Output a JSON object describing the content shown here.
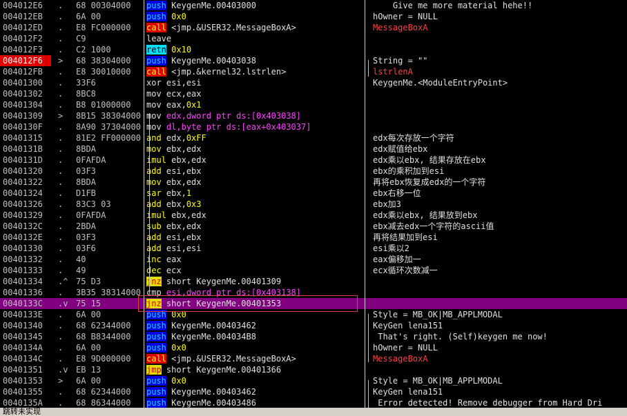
{
  "rows": [
    {
      "addr": "004012E6",
      "mark": ".",
      "hex": "68 00304000",
      "mn": "push",
      "op": "KeygenMe.00403000",
      "cmt": "    Give me more material hehe!!",
      "mnc": "push",
      "opc": "plain",
      "cmtc": "white"
    },
    {
      "addr": "004012EB",
      "mark": ".",
      "hex": "6A 00",
      "mn": "push",
      "op": "0x0",
      "cmt": "hOwner = NULL",
      "mnc": "push",
      "opc": "hex",
      "cmtc": "white"
    },
    {
      "addr": "004012ED",
      "mark": ".",
      "hex": "E8 FC000000",
      "mn": "call",
      "op": "<jmp.&USER32.MessageBoxA>",
      "cmt": "MessageBoxA",
      "mnc": "call",
      "opc": "plain",
      "cmtc": "red"
    },
    {
      "addr": "004012F2",
      "mark": ".",
      "hex": "C9",
      "mn": "leave",
      "op": "",
      "cmt": "",
      "mnc": "plainmn",
      "opc": "plain",
      "cmtc": "white"
    },
    {
      "addr": "004012F3",
      "mark": ".",
      "hex": "C2 1000",
      "mn": "retn",
      "op": "0x10",
      "cmt": "",
      "mnc": "retn",
      "opc": "hex",
      "cmtc": "white"
    },
    {
      "addr": "004012F6",
      "mark": ">",
      "hex": "68 38304000",
      "mn": "push",
      "op": "KeygenMe.00403038",
      "cmt": "String = \"\"",
      "mnc": "push",
      "opc": "plain",
      "cmtc": "white",
      "eip": true
    },
    {
      "addr": "004012FB",
      "mark": ".",
      "hex": "E8 30010000",
      "mn": "call",
      "op": "<jmp.&kernel32.lstrlen>",
      "cmt": "lstrlenA",
      "mnc": "call",
      "opc": "plain",
      "cmtc": "red"
    },
    {
      "addr": "00401300",
      "mark": ".",
      "hex": "33F6",
      "mn": "xor",
      "op": "esi,esi",
      "cmt": "KeygenMe.<ModuleEntryPoint>",
      "mnc": "plainmn",
      "opc": "plain",
      "cmtc": "white"
    },
    {
      "addr": "00401302",
      "mark": ".",
      "hex": "8BC8",
      "mn": "mov",
      "op": "ecx,eax",
      "cmt": "",
      "mnc": "plainmn",
      "opc": "plain",
      "cmtc": "white"
    },
    {
      "addr": "00401304",
      "mark": ".",
      "hex": "B8 01000000",
      "mn": "mov",
      "op": "eax,0x1",
      "cmt": "",
      "mnc": "plainmn",
      "opc": "mixhex",
      "cmtc": "white"
    },
    {
      "addr": "00401309",
      "mark": ">",
      "hex": "8B15 38304000",
      "mn": "mov",
      "op": "edx,dword ptr ds:[0x403038]",
      "cmt": "",
      "mnc": "plainmn",
      "opc": "mem",
      "cmtc": "white"
    },
    {
      "addr": "0040130F",
      "mark": ".",
      "hex": "8A90 37304000",
      "mn": "mov",
      "op": "dl,byte ptr ds:[eax+0x403037]",
      "cmt": "",
      "mnc": "plainmn",
      "opc": "mem",
      "cmtc": "white"
    },
    {
      "addr": "00401315",
      "mark": ".",
      "hex": "81E2 FF000000",
      "mn": "and",
      "op": "edx,0xFF",
      "cmt": "edx每次存放一个字符",
      "mnc": "arith",
      "opc": "mixhex",
      "cmtc": "white"
    },
    {
      "addr": "0040131B",
      "mark": ".",
      "hex": "8BDA",
      "mn": "mov",
      "op": "ebx,edx",
      "cmt": "edx赋值给ebx",
      "mnc": "arith",
      "opc": "plain",
      "cmtc": "white"
    },
    {
      "addr": "0040131D",
      "mark": ".",
      "hex": "0FAFDA",
      "mn": "imul",
      "op": "ebx,edx",
      "cmt": "edx乘以ebx, 结果存放在ebx",
      "mnc": "arith",
      "opc": "plain",
      "cmtc": "white"
    },
    {
      "addr": "00401320",
      "mark": ".",
      "hex": "03F3",
      "mn": "add",
      "op": "esi,ebx",
      "cmt": "ebx的乘积加到esi",
      "mnc": "arith",
      "opc": "plain",
      "cmtc": "white"
    },
    {
      "addr": "00401322",
      "mark": ".",
      "hex": "8BDA",
      "mn": "mov",
      "op": "ebx,edx",
      "cmt": "再将ebx恢复成edx的一个字符",
      "mnc": "arith",
      "opc": "plain",
      "cmtc": "white"
    },
    {
      "addr": "00401324",
      "mark": ".",
      "hex": "D1FB",
      "mn": "sar",
      "op": "ebx,1",
      "cmt": "ebx右移一位",
      "mnc": "arith",
      "opc": "mixhex",
      "cmtc": "white"
    },
    {
      "addr": "00401326",
      "mark": ".",
      "hex": "83C3 03",
      "mn": "add",
      "op": "ebx,0x3",
      "cmt": "ebx加3",
      "mnc": "arith",
      "opc": "mixhex",
      "cmtc": "white"
    },
    {
      "addr": "00401329",
      "mark": ".",
      "hex": "0FAFDA",
      "mn": "imul",
      "op": "ebx,edx",
      "cmt": "edx乘以ebx, 结果放到ebx",
      "mnc": "arith",
      "opc": "plain",
      "cmtc": "white"
    },
    {
      "addr": "0040132C",
      "mark": ".",
      "hex": "2BDA",
      "mn": "sub",
      "op": "ebx,edx",
      "cmt": "ebx减去edx一个字符的ascii值",
      "mnc": "arith",
      "opc": "plain",
      "cmtc": "white"
    },
    {
      "addr": "0040132E",
      "mark": ".",
      "hex": "03F3",
      "mn": "add",
      "op": "esi,ebx",
      "cmt": "再将结果加到esi",
      "mnc": "arith",
      "opc": "plain",
      "cmtc": "white"
    },
    {
      "addr": "00401330",
      "mark": ".",
      "hex": "03F6",
      "mn": "add",
      "op": "esi,esi",
      "cmt": "esi乘以2",
      "mnc": "arith",
      "opc": "plain",
      "cmtc": "white"
    },
    {
      "addr": "00401332",
      "mark": ".",
      "hex": "40",
      "mn": "inc",
      "op": "eax",
      "cmt": "eax偏移加一",
      "mnc": "arith",
      "opc": "plain",
      "cmtc": "white"
    },
    {
      "addr": "00401333",
      "mark": ".",
      "hex": "49",
      "mn": "dec",
      "op": "ecx",
      "cmt": "ecx循环次数减一",
      "mnc": "arith",
      "opc": "plain",
      "cmtc": "white"
    },
    {
      "addr": "00401334",
      "mark": ".^",
      "hex": "75 D3",
      "mn": "jnz",
      "op": "short KeygenMe.00401309",
      "cmt": "",
      "mnc": "jcc",
      "opc": "plain",
      "cmtc": "white"
    },
    {
      "addr": "00401336",
      "mark": ".",
      "hex": "3B35 38314000",
      "mn": "cmp",
      "op": "esi,dword ptr ds:[0x403138]",
      "cmt": "",
      "mnc": "plainmn",
      "opc": "mem",
      "cmtc": "white"
    },
    {
      "addr": "0040133C",
      "mark": ".v",
      "hex": "75 15",
      "mn": "jnz",
      "op": "short KeygenMe.00401353",
      "cmt": "",
      "mnc": "jcc",
      "opc": "plain",
      "cmtc": "white",
      "hl": true
    },
    {
      "addr": "0040133E",
      "mark": ".",
      "hex": "6A 00",
      "mn": "push",
      "op": "0x0",
      "cmt": "Style = MB_OK|MB_APPLMODAL",
      "mnc": "push",
      "opc": "hex",
      "cmtc": "white"
    },
    {
      "addr": "00401340",
      "mark": ".",
      "hex": "68 62344000",
      "mn": "push",
      "op": "KeygenMe.00403462",
      "cmt": "KeyGen lena151",
      "mnc": "push",
      "opc": "plain",
      "cmtc": "white"
    },
    {
      "addr": "00401345",
      "mark": ".",
      "hex": "68 B8344000",
      "mn": "push",
      "op": "KeygenMe.004034B8",
      "cmt": " That's right. (Self)keygen me now!",
      "mnc": "push",
      "opc": "plain",
      "cmtc": "white"
    },
    {
      "addr": "0040134A",
      "mark": ".",
      "hex": "6A 00",
      "mn": "push",
      "op": "0x0",
      "cmt": "hOwner = NULL",
      "mnc": "push",
      "opc": "hex",
      "cmtc": "white"
    },
    {
      "addr": "0040134C",
      "mark": ".",
      "hex": "E8 9D000000",
      "mn": "call",
      "op": "<jmp.&USER32.MessageBoxA>",
      "cmt": "MessageBoxA",
      "mnc": "call",
      "opc": "plain",
      "cmtc": "red"
    },
    {
      "addr": "00401351",
      "mark": ".v",
      "hex": "EB 13",
      "mn": "jmp",
      "op": "short KeygenMe.00401366",
      "cmt": "",
      "mnc": "jmp",
      "opc": "plain",
      "cmtc": "white"
    },
    {
      "addr": "00401353",
      "mark": ">",
      "hex": "6A 00",
      "mn": "push",
      "op": "0x0",
      "cmt": "Style = MB_OK|MB_APPLMODAL",
      "mnc": "push",
      "opc": "hex",
      "cmtc": "white"
    },
    {
      "addr": "00401355",
      "mark": ".",
      "hex": "68 62344000",
      "mn": "push",
      "op": "KeygenMe.00403462",
      "cmt": "KeyGen lena151",
      "mnc": "push",
      "opc": "plain",
      "cmtc": "white"
    },
    {
      "addr": "0040135A",
      "mark": ".",
      "hex": "68 86344000",
      "mn": "push",
      "op": "KeygenMe.00403486",
      "cmt": " Error detected! Remove debugger from Hard Dri",
      "mnc": "push",
      "opc": "plain",
      "cmtc": "white"
    }
  ],
  "status": "跳转未实现",
  "colors": {
    "highlight": "#800080",
    "eip": "#e00000"
  }
}
